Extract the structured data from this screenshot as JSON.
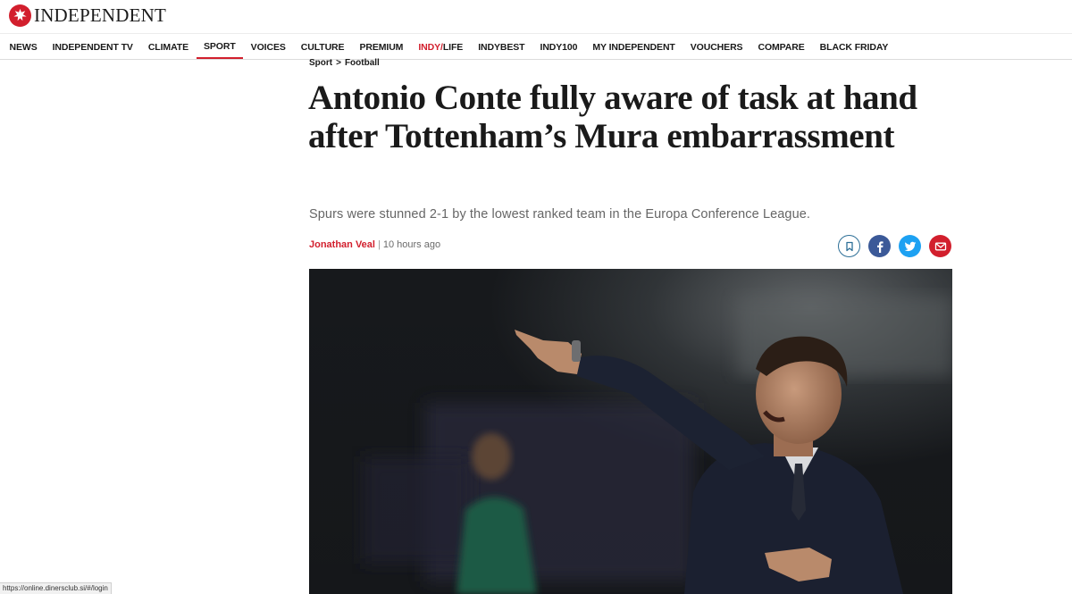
{
  "brand": {
    "name": "INDEPENDENT",
    "color": "#d21f2d"
  },
  "nav": [
    {
      "label": "NEWS"
    },
    {
      "label": "INDEPENDENT TV"
    },
    {
      "label": "CLIMATE"
    },
    {
      "label": "SPORT",
      "active": true
    },
    {
      "label": "VOICES"
    },
    {
      "label": "CULTURE"
    },
    {
      "label": "PREMIUM"
    },
    {
      "label_red": "INDY/",
      "label_rest": "LIFE"
    },
    {
      "label": "INDYBEST"
    },
    {
      "label": "INDY100"
    },
    {
      "label": "MY INDEPENDENT"
    },
    {
      "label": "VOUCHERS"
    },
    {
      "label": "COMPARE"
    },
    {
      "label": "BLACK FRIDAY"
    }
  ],
  "article": {
    "breadcrumb": {
      "section": "Sport",
      "separator": ">",
      "subsection": "Football"
    },
    "headline": "Antonio Conte fully aware of task at hand after Tottenham’s Mura embarrassment",
    "standfirst": "Spurs were stunned 2-1 by the lowest ranked team in the Europa Conference League.",
    "author": "Jonathan Veal",
    "byline_separator": "|",
    "time": "10 hours ago",
    "share_icons": [
      "bookmark-icon",
      "facebook-icon",
      "twitter-icon",
      "email-icon"
    ],
    "photo": {
      "icon": "photo-manager-pointing"
    }
  },
  "status_bar": {
    "url": "https://online.dinersclub.si/#/login"
  }
}
